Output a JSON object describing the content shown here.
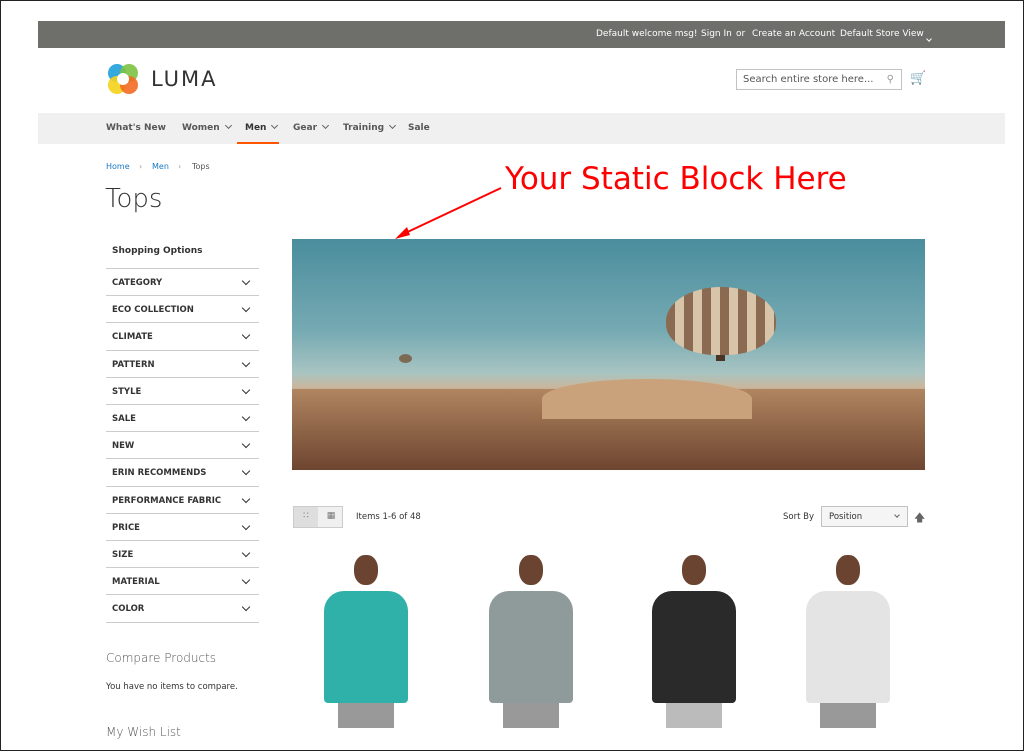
{
  "topbar": {
    "welcome": "Default welcome msg!",
    "sign_in": "Sign In",
    "or": "or",
    "create_account": "Create an Account",
    "store_view": "Default Store View"
  },
  "header": {
    "logo_text": "LUMA",
    "search_placeholder": "Search entire store here...",
    "icons": [
      "search-icon",
      "cart-icon"
    ]
  },
  "nav": [
    {
      "label": "What's New"
    },
    {
      "label": "Women",
      "dropdown": true
    },
    {
      "label": "Men",
      "dropdown": true,
      "active": true
    },
    {
      "label": "Gear",
      "dropdown": true
    },
    {
      "label": "Training",
      "dropdown": true
    },
    {
      "label": "Sale"
    }
  ],
  "breadcrumb": [
    "Home",
    "Men",
    "Tops"
  ],
  "page_title": "Tops",
  "annotation": {
    "text": "Your Static Block Here",
    "color": "#ff0000"
  },
  "sidebar": {
    "title": "Shopping Options",
    "filters": [
      "CATEGORY",
      "ECO COLLECTION",
      "CLIMATE",
      "PATTERN",
      "STYLE",
      "SALE",
      "NEW",
      "ERIN RECOMMENDS",
      "PERFORMANCE FABRIC",
      "PRICE",
      "SIZE",
      "MATERIAL",
      "COLOR"
    ],
    "compare_title": "Compare Products",
    "compare_empty": "You have no items to compare.",
    "wishlist_title": "My Wish List"
  },
  "toolbar": {
    "items_count": "Items 1-6 of 48",
    "sort_label": "Sort By",
    "sort_value": "Position",
    "view_modes": [
      "grid",
      "list"
    ]
  },
  "products": [
    {
      "color": "#2fb0a8"
    },
    {
      "color": "#8f9a9a"
    },
    {
      "color": "#2a2a2a"
    },
    {
      "color": "#e4e4e4"
    }
  ],
  "colors": {
    "topbar": "#6e6e6b",
    "nav_active_underline": "#ff5501",
    "link": "#1979c3"
  }
}
